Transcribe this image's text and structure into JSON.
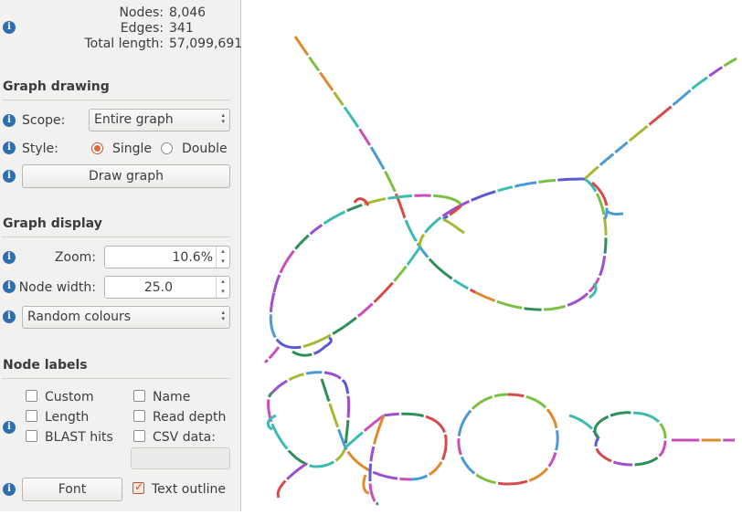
{
  "summary": {
    "nodes_label": "Nodes:",
    "nodes_value": "8,046",
    "edges_label": "Edges:",
    "edges_value": "341",
    "length_label": "Total length:",
    "length_value": "57,099,691"
  },
  "graph_drawing": {
    "heading": "Graph drawing",
    "scope_label": "Scope:",
    "scope_value": "Entire graph",
    "style_label": "Style:",
    "style_single": "Single",
    "style_double": "Double",
    "style_selected": "Single",
    "draw_button": "Draw graph"
  },
  "graph_display": {
    "heading": "Graph display",
    "zoom_label": "Zoom:",
    "zoom_value": "10.6%",
    "node_width_label": "Node width:",
    "node_width_value": "25.0",
    "colour_value": "Random colours"
  },
  "node_labels": {
    "heading": "Node labels",
    "custom": "Custom",
    "name": "Name",
    "length": "Length",
    "read_depth": "Read depth",
    "blast_hits": "BLAST hits",
    "csv_data": "CSV data:",
    "text_outline_checked": true,
    "font_button": "Font",
    "text_outline": "Text outline"
  },
  "icons": {
    "info": "info-icon",
    "info_glyph": "i",
    "spin_arrows": "▴\n▾",
    "combo_arrows": "▴\n▾"
  },
  "colors": {
    "accent": "#e0683a",
    "info": "#2d6fb3",
    "segments": [
      "#4a9bd4",
      "#d64a4a",
      "#7bc043",
      "#9b4fd1",
      "#3cbcb0",
      "#e08a2e",
      "#5a5ad6",
      "#c94fb8",
      "#a6b936",
      "#2f8f5b"
    ]
  }
}
